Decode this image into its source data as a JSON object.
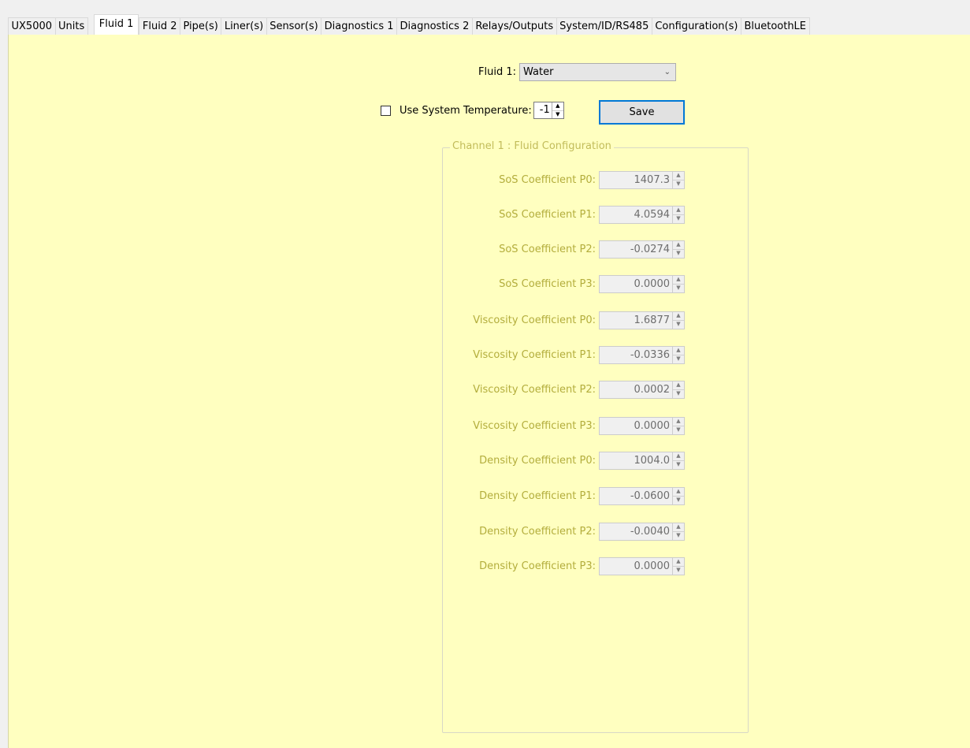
{
  "tabs": [
    {
      "label": "UX5000"
    },
    {
      "label": "Units"
    },
    {
      "label": "Fluid 1"
    },
    {
      "label": "Fluid 2"
    },
    {
      "label": "Pipe(s)"
    },
    {
      "label": "Liner(s)"
    },
    {
      "label": "Sensor(s)"
    },
    {
      "label": "Diagnostics 1"
    },
    {
      "label": "Diagnostics 2"
    },
    {
      "label": "Relays/Outputs"
    },
    {
      "label": "System/ID/RS485"
    },
    {
      "label": "Configuration(s)"
    },
    {
      "label": "BluetoothLE"
    }
  ],
  "active_tab": "Fluid 1",
  "fluid": {
    "label": "Fluid 1:",
    "selected": "Water"
  },
  "temperature": {
    "label": "Use System Temperature:",
    "checked": false,
    "value": "-1"
  },
  "save_label": "Save",
  "group": {
    "title": "Channel 1 : Fluid Configuration",
    "rows": [
      {
        "label": "SoS Coefficient P0:",
        "value": "1407.3"
      },
      {
        "label": "SoS Coefficient P1:",
        "value": "4.0594"
      },
      {
        "label": "SoS Coefficient P2:",
        "value": "-0.0274"
      },
      {
        "label": "SoS Coefficient P3:",
        "value": "0.0000"
      },
      {
        "label": "Viscosity Coefficient P0:",
        "value": "1.6877"
      },
      {
        "label": "Viscosity Coefficient P1:",
        "value": "-0.0336"
      },
      {
        "label": "Viscosity Coefficient P2:",
        "value": "0.0002"
      },
      {
        "label": "Viscosity Coefficient P3:",
        "value": "0.0000"
      },
      {
        "label": "Density Coefficient P0:",
        "value": "1004.0"
      },
      {
        "label": "Density Coefficient P1:",
        "value": "-0.0600"
      },
      {
        "label": "Density Coefficient P2:",
        "value": "-0.0040"
      },
      {
        "label": "Density Coefficient P3:",
        "value": "0.0000"
      }
    ]
  },
  "colors": {
    "panel_bg": "#ffffc0",
    "disabled_label": "#b3ad3c",
    "focus_border": "#0078d7"
  }
}
